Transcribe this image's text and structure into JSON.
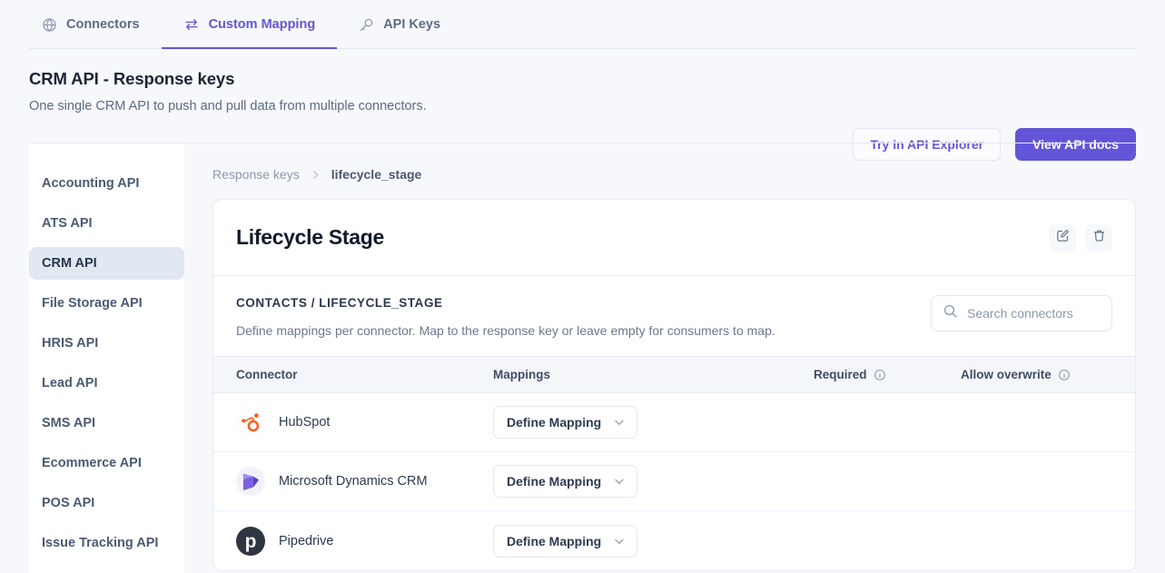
{
  "tabs": [
    {
      "label": "Connectors",
      "icon": "globe-icon",
      "active": false
    },
    {
      "label": "Custom Mapping",
      "icon": "exchange-arrows-icon",
      "active": true
    },
    {
      "label": "API Keys",
      "icon": "key-icon",
      "active": false
    }
  ],
  "header": {
    "title": "CRM API - Response keys",
    "subtitle": "One single CRM API to push and pull data from multiple connectors.",
    "secondary_button": "Try in API Explorer",
    "primary_button": "View API docs"
  },
  "sidebar": {
    "items": [
      {
        "label": "Accounting API",
        "active": false
      },
      {
        "label": "ATS API",
        "active": false
      },
      {
        "label": "CRM API",
        "active": true
      },
      {
        "label": "File Storage API",
        "active": false
      },
      {
        "label": "HRIS API",
        "active": false
      },
      {
        "label": "Lead API",
        "active": false
      },
      {
        "label": "SMS API",
        "active": false
      },
      {
        "label": "Ecommerce API",
        "active": false
      },
      {
        "label": "POS API",
        "active": false
      },
      {
        "label": "Issue Tracking API",
        "active": false
      }
    ]
  },
  "breadcrumb": {
    "root": "Response keys",
    "current": "lifecycle_stage"
  },
  "card": {
    "title": "Lifecycle Stage",
    "edit_icon": "edit-pencil-icon",
    "delete_icon": "trash-icon",
    "section_label": "CONTACTS / LIFECYCLE_STAGE",
    "section_description": "Define mappings per connector. Map to the response key or leave empty for consumers to map.",
    "search_placeholder": "Search connectors",
    "search_value": ""
  },
  "table": {
    "headers": {
      "connector": "Connector",
      "mappings": "Mappings",
      "required": "Required",
      "allow_overwrite": "Allow overwrite"
    },
    "rows": [
      {
        "connector": "HubSpot",
        "logo": "hubspot-logo",
        "mapping_label": "Define Mapping",
        "required": "",
        "allow_overwrite": ""
      },
      {
        "connector": "Microsoft Dynamics CRM",
        "logo": "microsoft-dynamics-logo",
        "mapping_label": "Define Mapping",
        "required": "",
        "allow_overwrite": ""
      },
      {
        "connector": "Pipedrive",
        "logo": "pipedrive-logo",
        "mapping_label": "Define Mapping",
        "required": "",
        "allow_overwrite": ""
      }
    ]
  },
  "colors": {
    "accent": "#6355d8",
    "hubspot_orange": "#ff5c1b",
    "dynamics_purple": "#6a4fd6",
    "pipedrive_dark": "#2f3542",
    "page_bg": "#f7f8fb"
  }
}
